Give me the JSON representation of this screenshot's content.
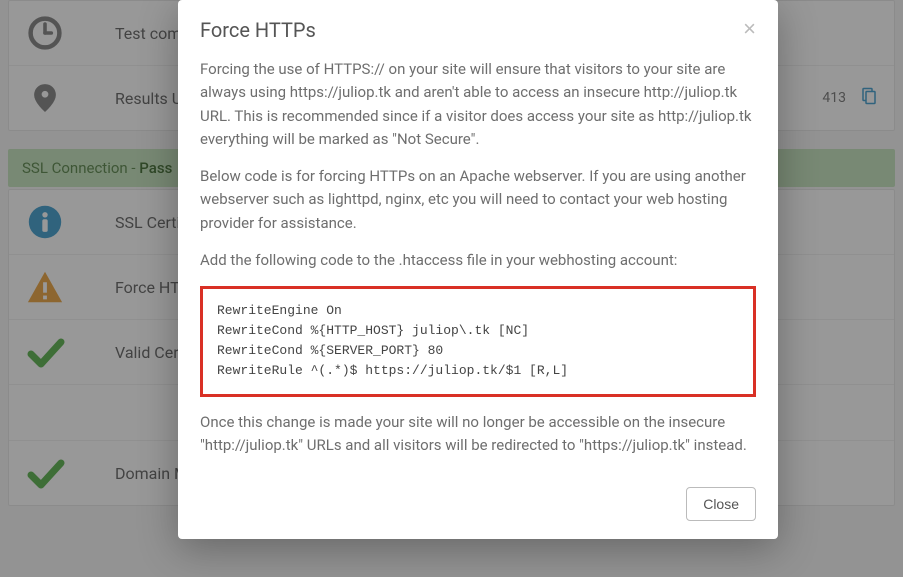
{
  "bg": {
    "row_test": "Test compl",
    "row_results": "Results URL",
    "results_code": "413",
    "ssl_banner_prefix": "SSL Connection - ",
    "ssl_banner_status": "Pass",
    "row_cert": "SSL Certifi",
    "row_force": "Force HTTP",
    "row_valid": "Valid Certi",
    "row_domain": "Domain Ma"
  },
  "modal": {
    "title": "Force HTTPs",
    "close_x": "×",
    "p1": "Forcing the use of HTTPS:// on your site will ensure that visitors to your site are always using https://juliop.tk and aren't able to access an insecure http://juliop.tk URL. This is recommended since if a visitor does access your site as http://juliop.tk everything will be marked as \"Not Secure\".",
    "p2": "Below code is for forcing HTTPs on an Apache webserver. If you are using another webserver such as lighttpd, nginx, etc you will need to contact your web hosting provider for assistance.",
    "p3": "Add the following code to the .htaccess file in your webhosting account:",
    "code": "RewriteEngine On\nRewriteCond %{HTTP_HOST} juliop\\.tk [NC]\nRewriteCond %{SERVER_PORT} 80\nRewriteRule ^(.*)$ https://juliop.tk/$1 [R,L]",
    "p4": "Once this change is made your site will no longer be accessible on the insecure \"http://juliop.tk\" URLs and all visitors will be redirected to \"https://juliop.tk\" instead.",
    "close_btn": "Close"
  }
}
